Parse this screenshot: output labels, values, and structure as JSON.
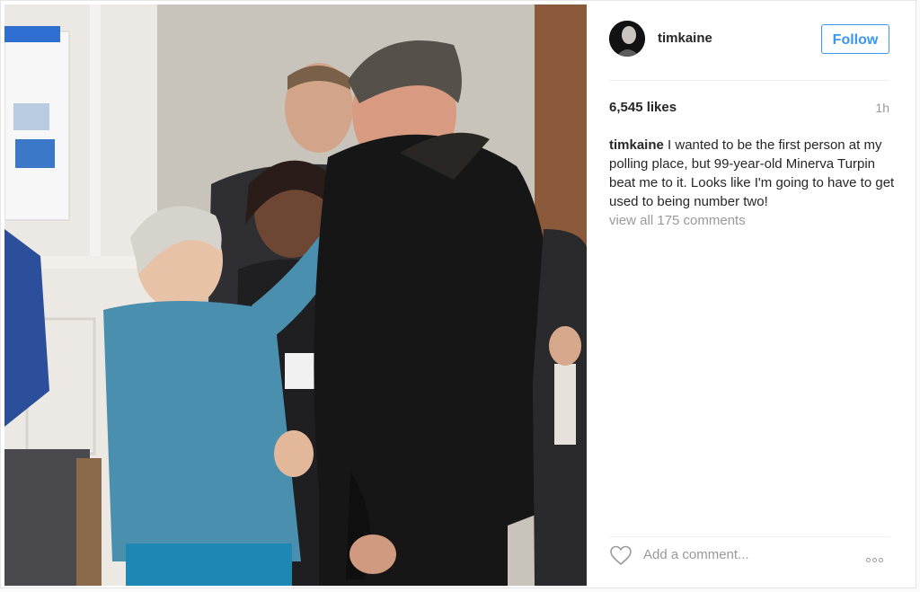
{
  "post": {
    "username": "timkaine",
    "follow_label": "Follow",
    "likes": "6,545 likes",
    "time": "1h",
    "caption_user": "timkaine",
    "caption_text": " I wanted to be the first person at my polling place, but 99-year-old Minerva Turpin beat me to it. Looks like I'm going to have to get used to being number two!",
    "view_comments": "view all 175 comments",
    "comment_placeholder": "Add a comment...",
    "icons": [
      "heart-icon",
      "more-options-icon"
    ]
  },
  "colors": {
    "accent": "#3897f0",
    "text": "#262626",
    "muted": "#999999",
    "border": "#efefef"
  }
}
